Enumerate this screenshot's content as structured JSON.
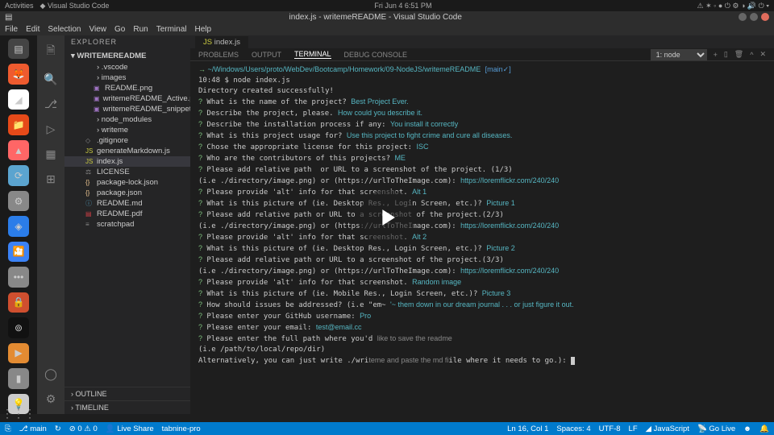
{
  "topbar": {
    "activities": "Activities",
    "app": "Visual Studio Code",
    "clock": "Fri Jun 4  6:51 PM"
  },
  "title": "index.js - writemeREADME - Visual Studio Code",
  "menu": [
    "File",
    "Edit",
    "Selection",
    "View",
    "Go",
    "Run",
    "Terminal",
    "Help"
  ],
  "explorer": {
    "label": "EXPLORER",
    "root": "WRITEMEREADME",
    "folders": [
      ".vscode",
      "images"
    ],
    "images_children": [
      "README.png",
      "writemeREADME_Active.png",
      "writemeREADME_snippet.png"
    ],
    "folders2": [
      "node_modules",
      "writeme"
    ],
    "files": [
      ".gitignore",
      "generateMarkdown.js",
      "index.js",
      "LICENSE",
      "package-lock.json",
      "package.json",
      "README.md",
      "README.pdf",
      "scratchpad"
    ],
    "outline": "OUTLINE",
    "timeline": "TIMELINE"
  },
  "editor_tab": "index.js",
  "panel": {
    "tabs": [
      "PROBLEMS",
      "OUTPUT",
      "TERMINAL",
      "DEBUG CONSOLE"
    ],
    "active": 2,
    "shell": "1: node"
  },
  "term": {
    "cwd": "~/Windows/Users/proto/WebDev/Bootcamp/Homework/09-NodeJS/writemeREADME",
    "branch": "[main✓]",
    "time": "10:48 $ node index.js",
    "msg": "Directory created successfully!",
    "q": [
      {
        "p": "What is the name of the project?",
        "a": "Best Project Ever."
      },
      {
        "p": "Describe the project, please.",
        "a": "How could you describe it."
      },
      {
        "p": "Describe the installation process if any:",
        "a": "You install it correctly"
      },
      {
        "p": "What is this project usage for?",
        "a": "Use this project to fight crime and cure all diseases."
      },
      {
        "p": "Chose the appropriate license for this project:",
        "a": "ISC"
      },
      {
        "p": "Who are the contributors of this projects?",
        "a": "ME"
      },
      {
        "p": "Please add relative path  or URL to a screenshot of the project. (1/3)\n(i.e ./directory/image.png) or (https://urlToTheImage.com):",
        "a": "https://loremflickr.com/240/240"
      },
      {
        "p": "Please provide 'alt' info for that screenshot.",
        "a": "Alt 1"
      },
      {
        "p": "What is this picture of (ie. Desktop Res., Login Screen, etc.)?",
        "a": "Picture 1"
      },
      {
        "p": "Please add relative path or URL to a screenshot of the project.(2/3)\n(i.e ./directory/image.png) or (https://urlToTheImage.com):",
        "a": "https://loremflickr.com/240/240"
      },
      {
        "p": "Please provide 'alt' info for that screenshot.",
        "a": "Alt 2"
      },
      {
        "p": "What is this picture of (ie. Desktop Res., Login Screen, etc.)?",
        "a": "Picture 2"
      },
      {
        "p": "Please add relative path or URL to a screenshot of the project.(3/3)\n(i.e ./directory/image.png) or (https://urlToTheImage.com):",
        "a": "https://loremflickr.com/240/240"
      },
      {
        "p": "Please provide 'alt' info for that screenshot.",
        "a": "Random image"
      },
      {
        "p": "What is this picture of (ie. Mobile Res., Login Screen, etc.)?",
        "a": "Picture 3"
      },
      {
        "p": "How should issues be addressed? (i.e \"em~",
        "a": "'~ them down in our dream journal . . . or just figure it out."
      },
      {
        "p": "Please enter your GitHub username:",
        "a": "Pro"
      },
      {
        "p": "Please enter your email:",
        "a": "test@email.cc"
      }
    ],
    "tail": {
      "l1": "Please enter the full path where you'd",
      "l1g": "like to save the readme",
      "l2": "(i.e /path/to/local/repo/dir)",
      "l3a": "Alternatively, you can just write ./wri",
      "l3b": "teme and paste the md fi",
      "l3c": "ile where it needs to go.):"
    }
  },
  "status": {
    "branch": "main",
    "sync": "↻",
    "errors": "0",
    "warnings": "0",
    "live": "Live Share",
    "tabnine": "tabnine-pro",
    "ln": "Ln 16, Col 1",
    "spaces": "Spaces: 4",
    "enc": "UTF-8",
    "eol": "LF",
    "lang": "JavaScript",
    "golive": "Go Live",
    "bell": "🔔"
  }
}
